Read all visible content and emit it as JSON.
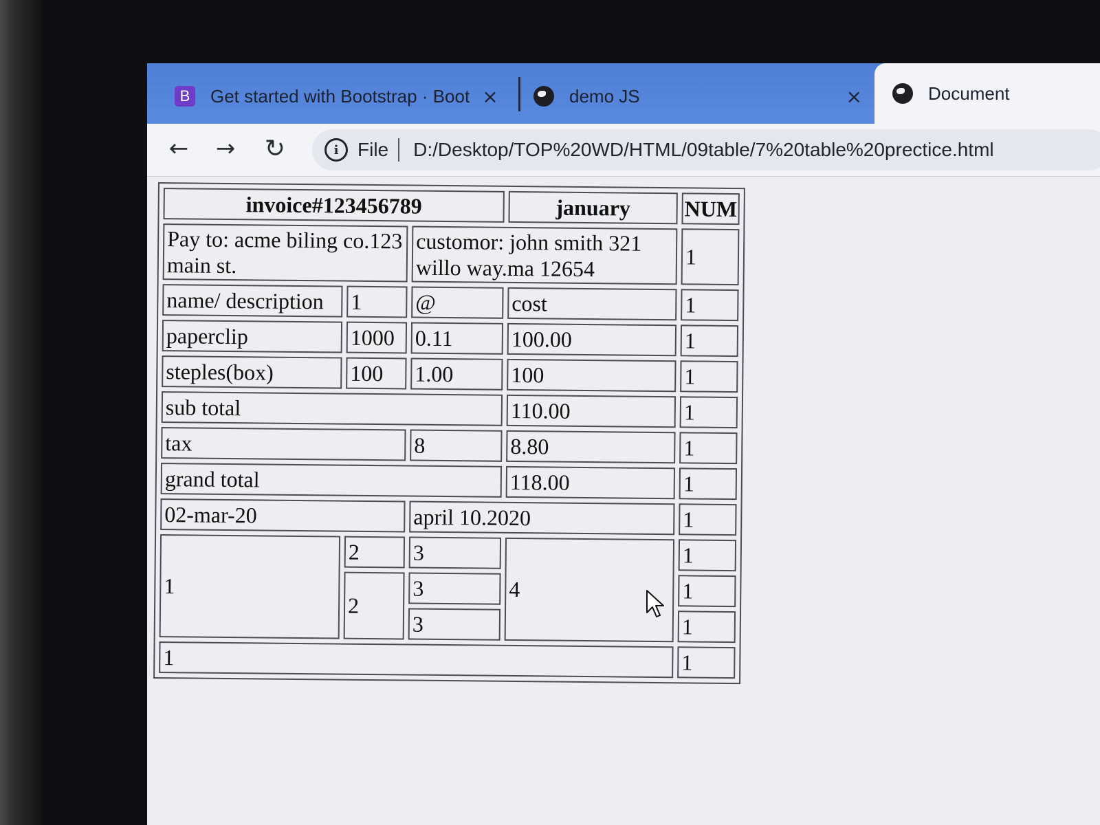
{
  "browser": {
    "tabs": [
      {
        "label": "Get started with Bootstrap · Boot",
        "favicon": "B"
      },
      {
        "label": "demo JS"
      },
      {
        "label": "Document"
      }
    ],
    "close_glyph": "×",
    "address": {
      "scheme_label": "File",
      "url": "D:/Desktop/TOP%20WD/HTML/09table/7%20table%20prectice.html"
    },
    "nav_icons": [
      "back-arrow-icon",
      "forward-arrow-icon",
      "reload-icon",
      "info-icon"
    ]
  },
  "invoice": {
    "header": {
      "invoice": "invoice#123456789",
      "month": "january",
      "num": "NUM"
    },
    "pay_to": "Pay to: acme biling co.123 main st.",
    "customer": "customor: john smith 321 willo way.ma 12654",
    "columns": {
      "name": "name/ description",
      "qty": "1",
      "at": "@",
      "cost": "cost"
    },
    "items": [
      {
        "name": "paperclip",
        "qty": "1000",
        "price": "0.11",
        "cost": "100.00"
      },
      {
        "name": "steples(box)",
        "qty": "100",
        "price": "1.00",
        "cost": "100"
      }
    ],
    "subtotal": {
      "label": "sub total",
      "value": "110.00"
    },
    "tax": {
      "label": "tax",
      "rate": "8",
      "value": "8.80"
    },
    "grand_total": {
      "label": "grand total",
      "value": "118.00"
    },
    "dates": {
      "left": "02-mar-20",
      "right": "april 10.2020"
    },
    "merged": {
      "a": "1",
      "b1": "2",
      "b2": "2",
      "c1": "3",
      "c2": "3",
      "c3": "3",
      "d": "4",
      "footer": "1"
    },
    "num_column": [
      "1",
      "1",
      "1",
      "1",
      "1",
      "1",
      "1",
      "1",
      "1",
      "1",
      "1",
      "1",
      "1"
    ]
  }
}
